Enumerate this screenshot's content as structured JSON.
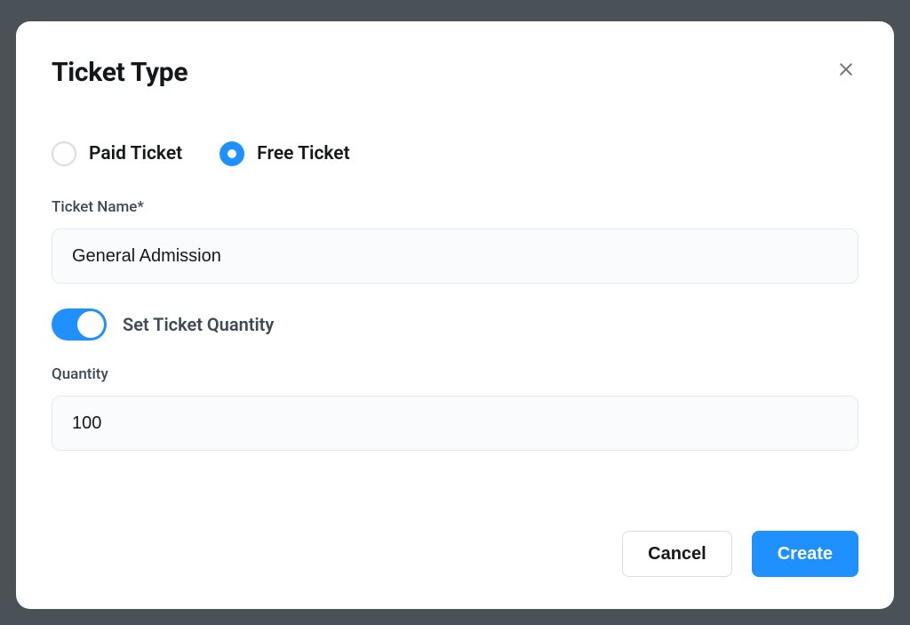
{
  "modal": {
    "title": "Ticket Type",
    "radios": {
      "paid": {
        "label": "Paid Ticket",
        "selected": false
      },
      "free": {
        "label": "Free Ticket",
        "selected": true
      }
    },
    "fields": {
      "name": {
        "label": "Ticket Name*",
        "value": "General Admission"
      },
      "quantityToggle": {
        "label": "Set Ticket Quantity",
        "on": true
      },
      "quantity": {
        "label": "Quantity",
        "value": "100"
      }
    },
    "buttons": {
      "cancel": "Cancel",
      "create": "Create"
    }
  }
}
